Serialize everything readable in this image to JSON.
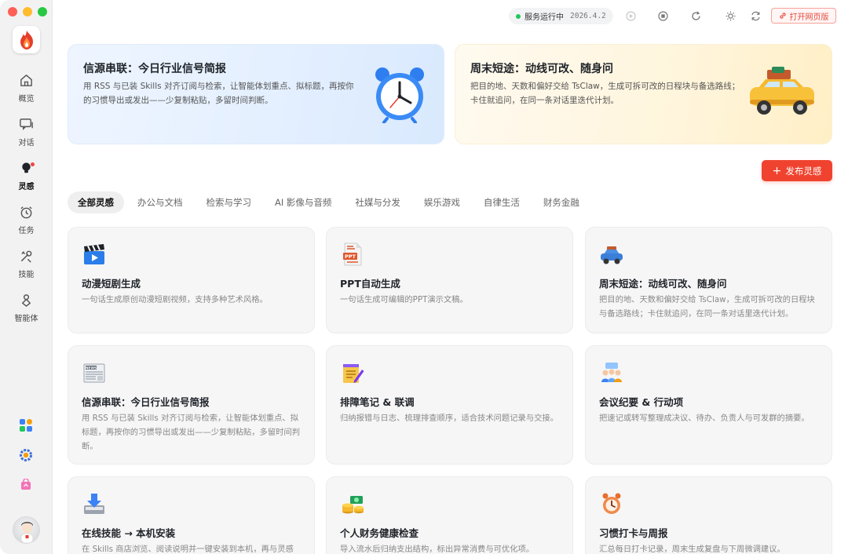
{
  "sidebar": {
    "items": [
      {
        "label": "概览",
        "icon": "home-icon"
      },
      {
        "label": "对话",
        "icon": "chat-icon"
      },
      {
        "label": "灵感",
        "icon": "bulb-icon"
      },
      {
        "label": "任务",
        "icon": "clock-icon"
      },
      {
        "label": "技能",
        "icon": "tools-icon"
      },
      {
        "label": "智能体",
        "icon": "agent-icon"
      }
    ]
  },
  "topbar": {
    "status_text": "服务运行中",
    "version": "2026.4.2",
    "open_web_label": "打开网页版"
  },
  "banners": [
    {
      "title": "信源串联：今日行业信号简报",
      "desc": "用 RSS 与已装 Skills 对齐订阅与检索，让智能体划重点、拟标题，再按你的习惯导出或发出——少复制粘贴，多留时间判断。"
    },
    {
      "title": "周末短途：动线可改、随身问",
      "desc": "把目的地、天数和偏好交给 TsClaw，生成可拆可改的日程块与备选路线；卡住就追问，在同一条对话里迭代计划。"
    }
  ],
  "publish_label": "发布灵感",
  "tabs": [
    "全部灵感",
    "办公与文档",
    "检索与学习",
    "AI 影像与音频",
    "社媒与分发",
    "娱乐游戏",
    "自律生活",
    "财务金融"
  ],
  "cards": [
    {
      "title": "动漫短剧生成",
      "desc": "一句话生成原创动漫短剧视频，支持多种艺术风格。"
    },
    {
      "title": "PPT自动生成",
      "desc": "一句话生成可编辑的PPT演示文稿。"
    },
    {
      "title": "周末短途：动线可改、随身问",
      "desc": "把目的地、天数和偏好交给 TsClaw，生成可拆可改的日程块与备选路线；卡住就追问，在同一条对话里迭代计划。"
    },
    {
      "title": "信源串联：今日行业信号简报",
      "desc": "用 RSS 与已装 Skills 对齐订阅与检索，让智能体划重点、拟标题，再按你的习惯导出或发出——少复制粘贴，多留时间判断。"
    },
    {
      "title": "排障笔记 & 联调",
      "desc": "归纳报错与日志、梳理排查顺序，适合技术问题记录与交接。"
    },
    {
      "title": "会议纪要 & 行动项",
      "desc": "把速记或转写整理成决议、待办、负责人与可发群的摘要。"
    },
    {
      "title": "在线技能 → 本机安装",
      "desc": "在 Skills 商店浏览、阅读说明并一键安装到本机，再与灵感"
    },
    {
      "title": "个人财务健康检查",
      "desc": "导入流水后归纳支出结构，标出异常消费与可优化项。"
    },
    {
      "title": "习惯打卡与周报",
      "desc": "汇总每日打卡记录，周末生成复盘与下周微调建议。"
    }
  ]
}
